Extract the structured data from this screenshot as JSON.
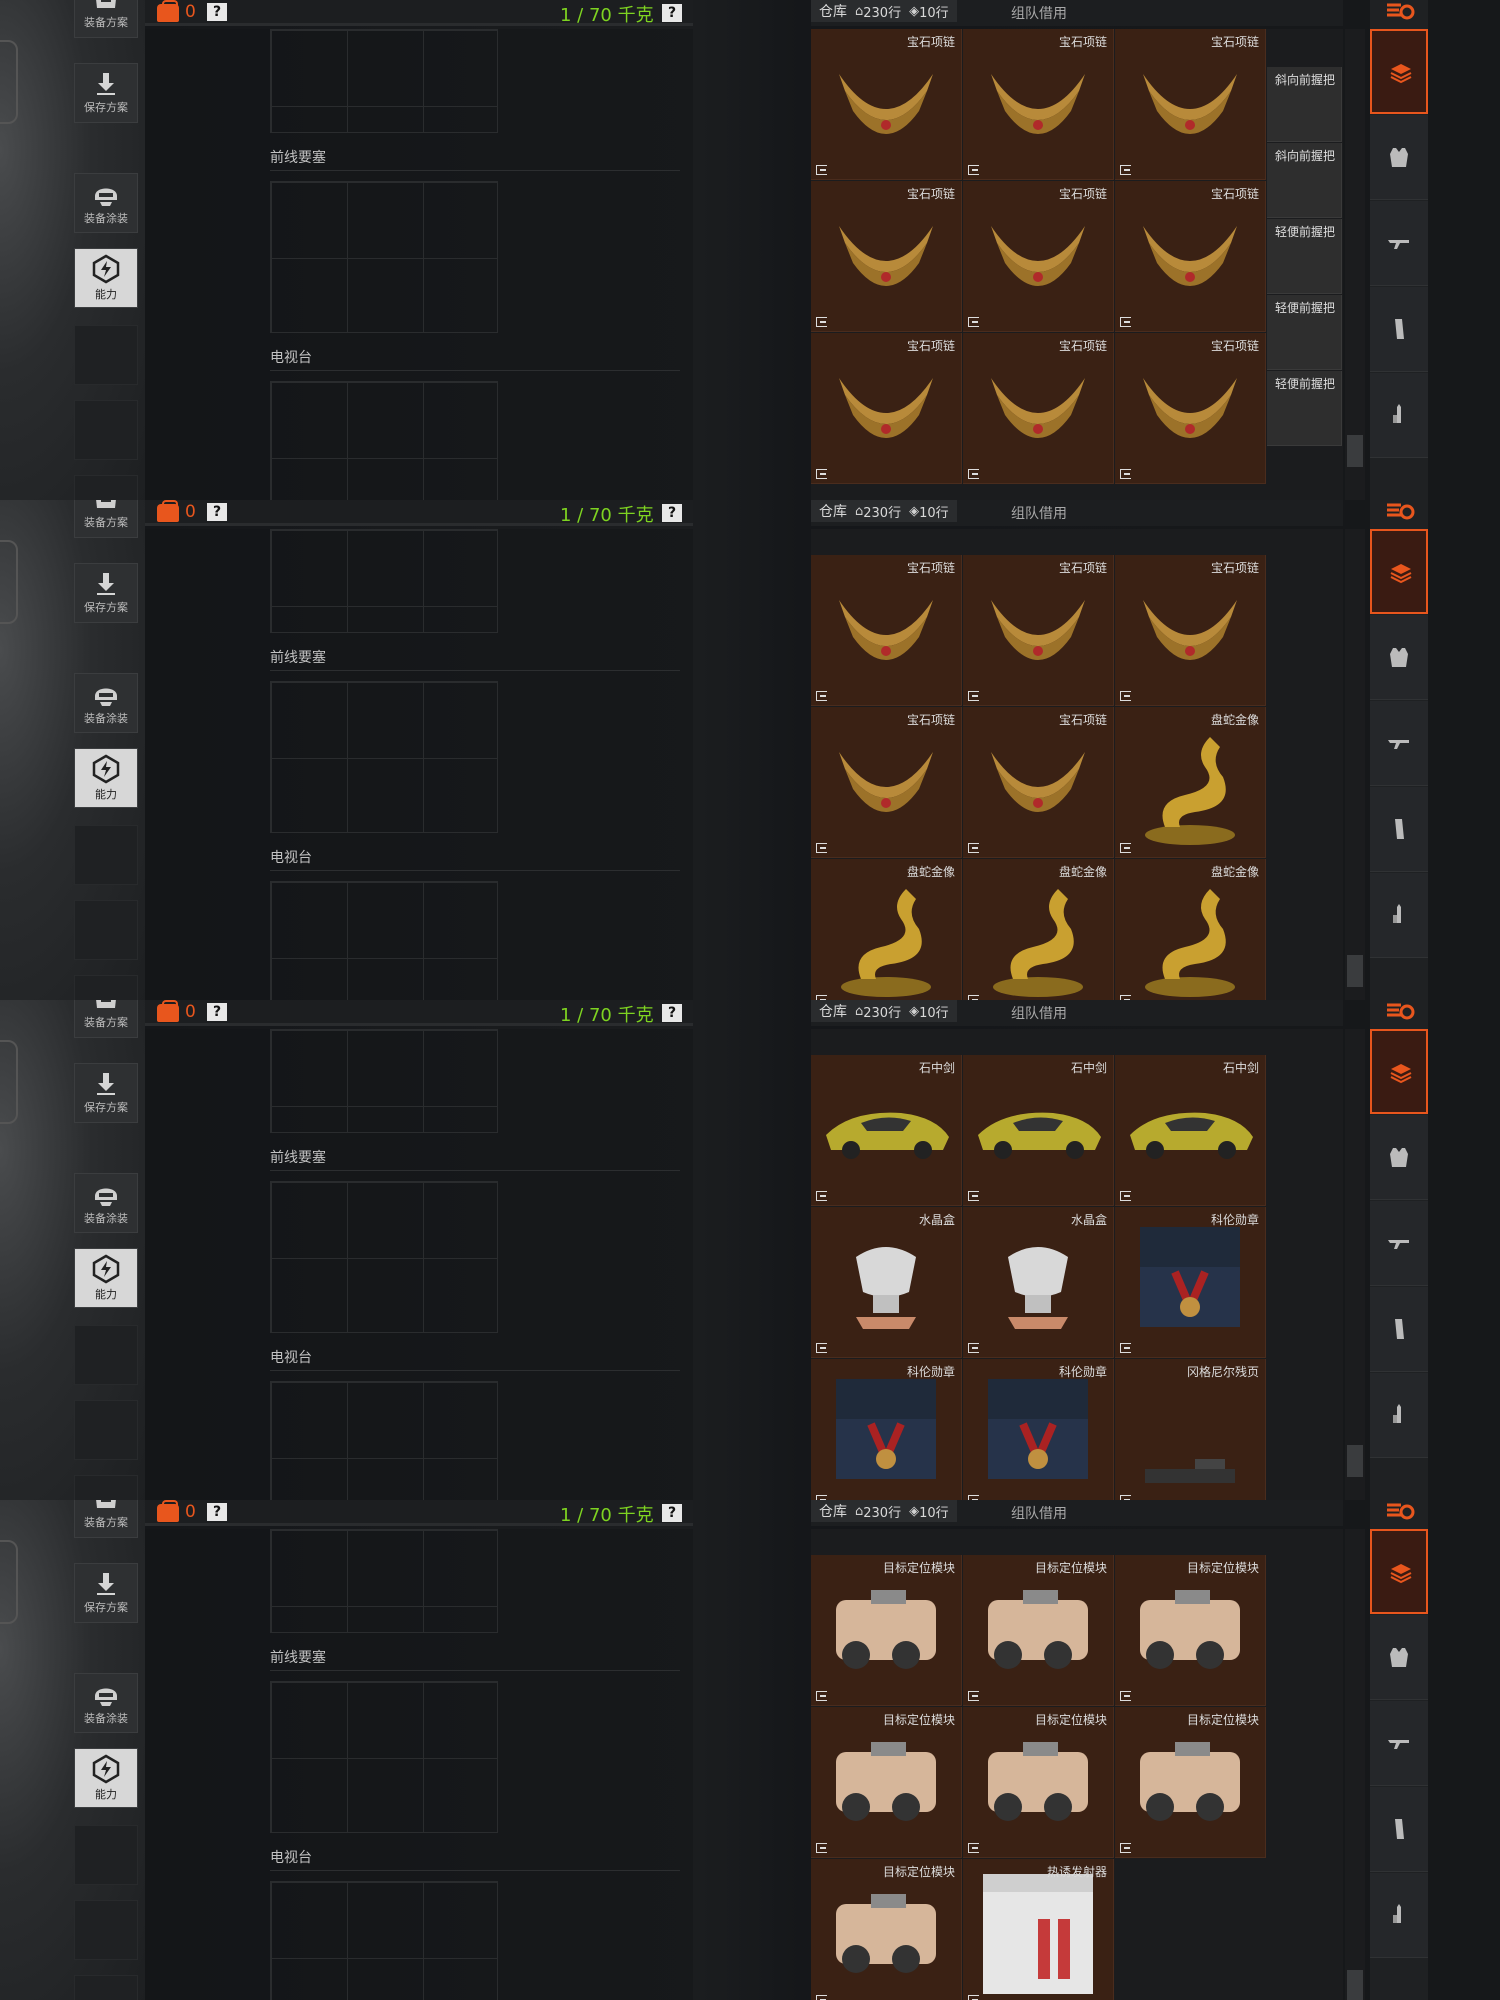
{
  "header": {
    "bag_count": "0",
    "help": "?",
    "weight": "1 / 70 千克"
  },
  "sidebar": {
    "equip_plan": "装备方案",
    "save_plan": "保存方案",
    "equip_skin": "装备涂装",
    "ability": "能力"
  },
  "sections": {
    "frontline": "前线要塞",
    "tv_station": "电视台"
  },
  "storage": {
    "tab_warehouse": "仓库",
    "rows_a": "230行",
    "rows_b": "10行",
    "tab_team": "组队借用"
  },
  "categories": [
    "layers-icon",
    "vest-icon",
    "rifle-icon",
    "magazine-icon",
    "ammo-icon"
  ],
  "panels": [
    {
      "rows": [
        [
          "宝石项链",
          "宝石项链",
          "宝石项链"
        ],
        [
          "宝石项链",
          "宝石项链",
          "宝石项链"
        ],
        [
          "宝石项链",
          "宝石项链",
          "宝石项链"
        ]
      ],
      "side_items": [
        "斜向前握把",
        "斜向前握把",
        "轻便前握把",
        "轻便前握把",
        "轻便前握把"
      ]
    },
    {
      "rows": [
        [
          "宝石项链",
          "宝石项链",
          "宝石项链"
        ],
        [
          "宝石项链",
          "宝石项链",
          "盘蛇金像"
        ],
        [
          "盘蛇金像",
          "盘蛇金像",
          "盘蛇金像"
        ]
      ]
    },
    {
      "rows": [
        [
          "石中剑",
          "石中剑",
          "石中剑"
        ],
        [
          "水晶盒",
          "水晶盒",
          "科伦勋章"
        ],
        [
          "科伦勋章",
          "科伦勋章",
          "冈格尼尔残页"
        ]
      ]
    },
    {
      "rows": [
        [
          "目标定位模块",
          "目标定位模块",
          "目标定位模块"
        ],
        [
          "目标定位模块",
          "目标定位模块",
          "目标定位模块"
        ],
        [
          "目标定位模块",
          "热诱发射器",
          ""
        ]
      ]
    }
  ],
  "colors": {
    "accent": "#e8561d",
    "weight": "#7ed321",
    "cell": "#3a2114"
  }
}
